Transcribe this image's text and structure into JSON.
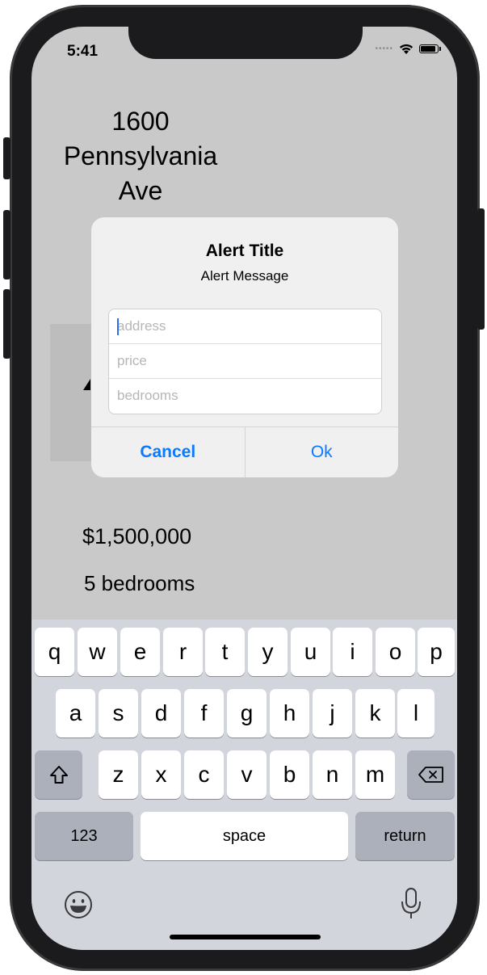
{
  "status": {
    "time": "5:41"
  },
  "listing": {
    "address_lines": [
      "1600",
      "Pennsylvania",
      "Ave"
    ],
    "price": "$1,500,000",
    "bedrooms": "5 bedrooms"
  },
  "alert": {
    "title": "Alert Title",
    "message": "Alert Message",
    "fields": [
      {
        "placeholder": "address"
      },
      {
        "placeholder": "price"
      },
      {
        "placeholder": "bedrooms"
      }
    ],
    "cancel_label": "Cancel",
    "ok_label": "Ok"
  },
  "keyboard": {
    "row1": [
      "q",
      "w",
      "e",
      "r",
      "t",
      "y",
      "u",
      "i",
      "o",
      "p"
    ],
    "row2": [
      "a",
      "s",
      "d",
      "f",
      "g",
      "h",
      "j",
      "k",
      "l"
    ],
    "row3": [
      "z",
      "x",
      "c",
      "v",
      "b",
      "n",
      "m"
    ],
    "numbers_label": "123",
    "space_label": "space",
    "return_label": "return"
  },
  "icons": {
    "wifi": "wifi-icon",
    "battery": "battery-icon",
    "shift": "shift-icon",
    "delete": "delete-icon",
    "emoji": "emoji-icon",
    "mic": "microphone-icon"
  }
}
